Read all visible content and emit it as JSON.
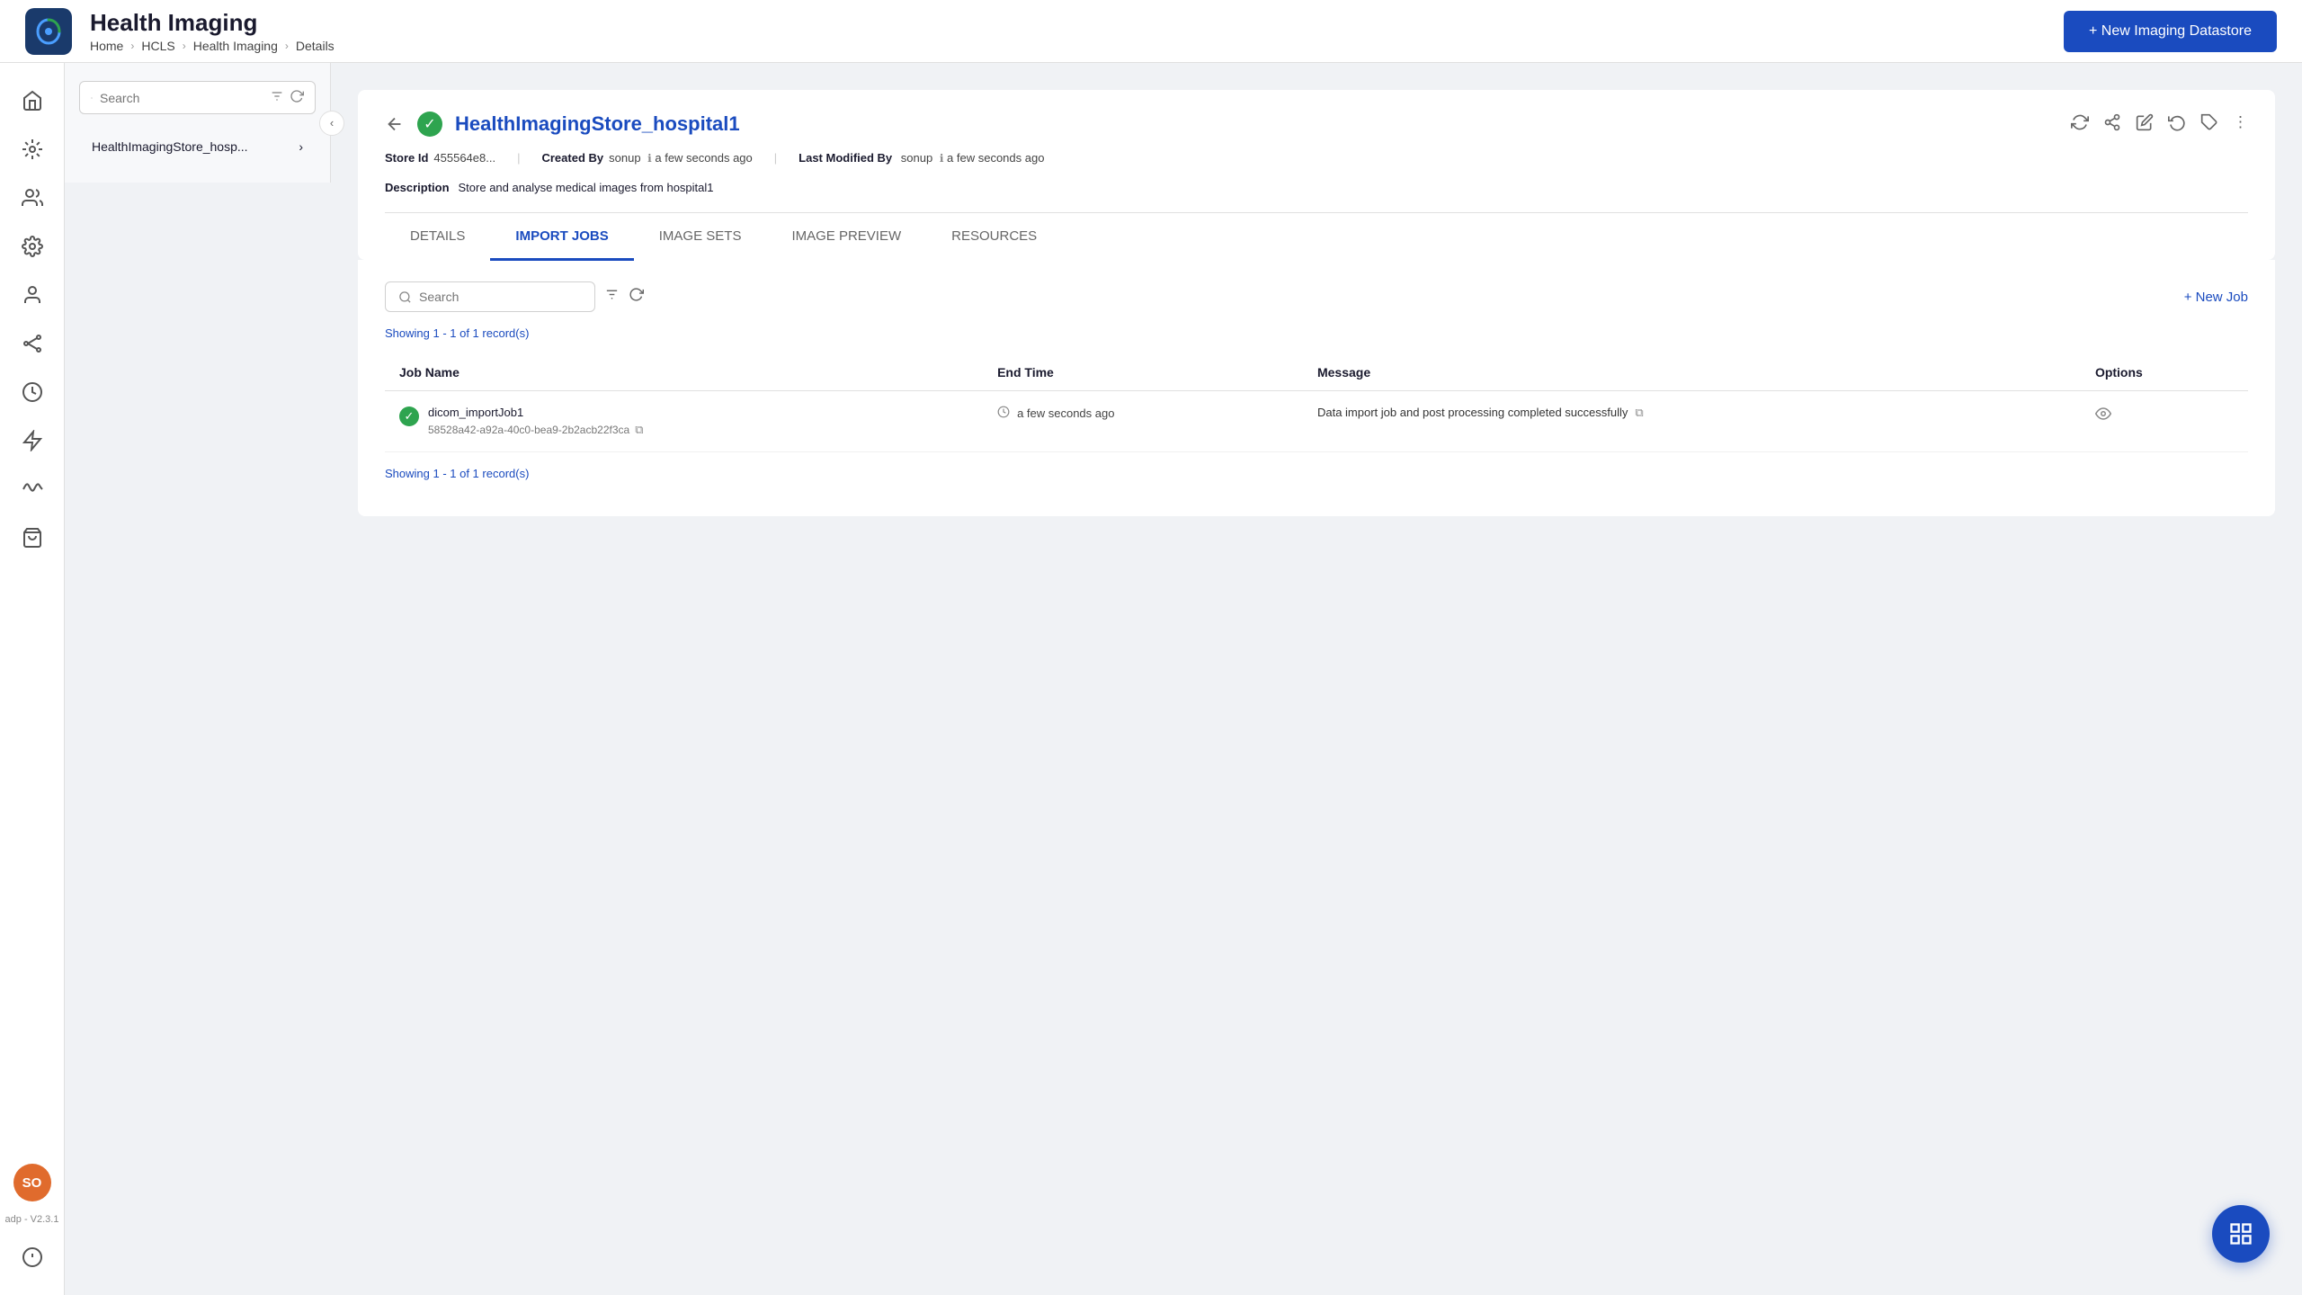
{
  "topbar": {
    "title": "Health Imaging",
    "breadcrumb": [
      "Home",
      "HCLS",
      "Health Imaging",
      "Details"
    ],
    "new_datastore_btn": "+ New Imaging Datastore"
  },
  "sidebar": {
    "user_initials": "SO",
    "version_label": "adp - V2.3.1"
  },
  "panel": {
    "search_placeholder": "Search",
    "item_label": "HealthImagingStore_hosp..."
  },
  "detail": {
    "store_name": "HealthImagingStore_hospital1",
    "store_id_label": "Store Id",
    "store_id_value": "455564e8...",
    "created_by_label": "Created By",
    "created_by_value": "sonup",
    "created_by_time": "a few seconds ago",
    "modified_by_label": "Last Modified By",
    "modified_by_value": "sonup",
    "modified_by_time": "a few seconds ago",
    "description_label": "Description",
    "description_value": "Store and analyse medical images from hospital1"
  },
  "tabs": [
    {
      "id": "details",
      "label": "DETAILS"
    },
    {
      "id": "import-jobs",
      "label": "IMPORT JOBS",
      "active": true
    },
    {
      "id": "image-sets",
      "label": "IMAGE SETS"
    },
    {
      "id": "image-preview",
      "label": "IMAGE PREVIEW"
    },
    {
      "id": "resources",
      "label": "RESOURCES"
    }
  ],
  "jobs": {
    "search_placeholder": "Search",
    "new_job_btn": "+ New Job",
    "record_count_top": "Showing 1 - 1 of 1 record(s)",
    "record_count_bottom": "Showing 1 - 1 of 1 record(s)",
    "columns": [
      "Job Name",
      "End Time",
      "Message",
      "Options"
    ],
    "rows": [
      {
        "name": "dicom_importJob1",
        "id": "58528a42-a92a-40c0-bea9-2b2acb22f3ca",
        "end_time": "a few seconds ago",
        "message": "Data import job and post processing completed successfully"
      }
    ]
  },
  "fab": {
    "icon": "⌘"
  }
}
